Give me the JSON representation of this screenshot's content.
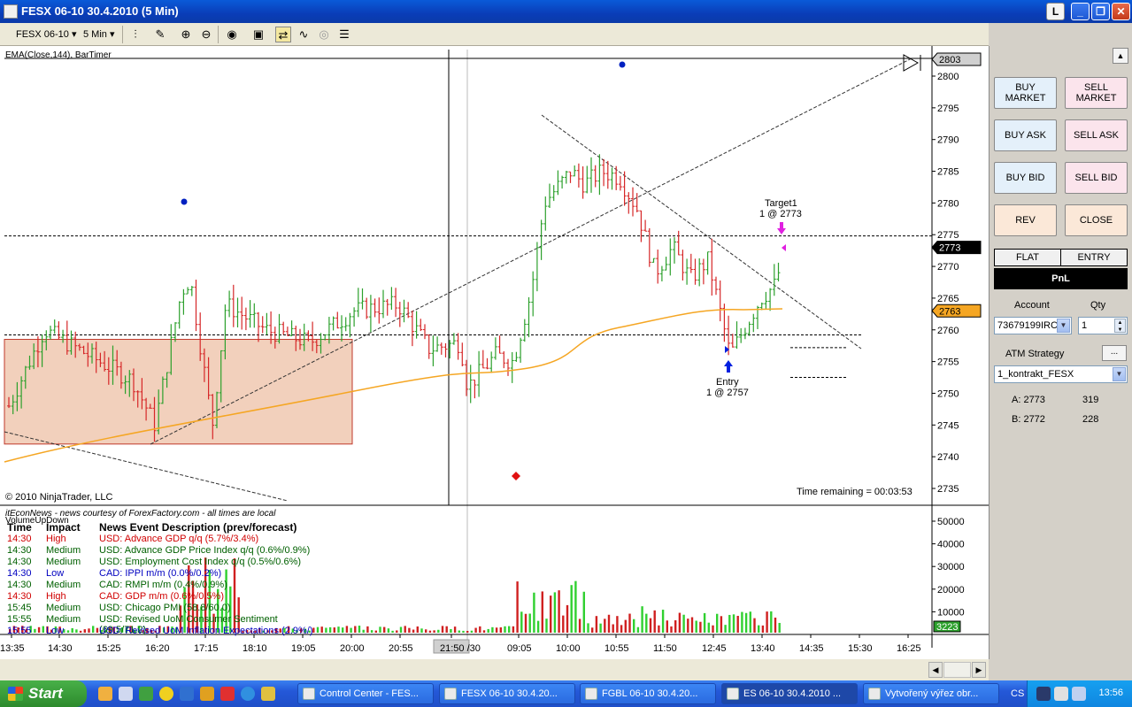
{
  "window": {
    "title": "FESX 06-10  30.4.2010  (5 Min)",
    "btn_l": "L",
    "btn_min": "_",
    "btn_max": "❐",
    "btn_close": "✕"
  },
  "toolbar": {
    "instrument": "FESX 06-10",
    "interval": "5 Min"
  },
  "chart": {
    "indicator_label": "EMA(Close,144), BarTimer",
    "copyright": "© 2010 NinjaTrader, LLC",
    "time_remaining": "Time remaining = 00:03:53",
    "price_ticks": [
      "2800",
      "2795",
      "2790",
      "2785",
      "2780",
      "2775",
      "2770",
      "2765",
      "2760",
      "2755",
      "2750",
      "2745",
      "2740",
      "2735"
    ],
    "price_top_box": "2803",
    "price_last_box": "2773",
    "price_ema_box": "2763",
    "target_label": "Target1",
    "target_qty": "1 @ 2773",
    "entry_label": "Entry",
    "entry_qty": "1 @ 2757",
    "volume_ticks": [
      "50000",
      "40000",
      "30000",
      "20000",
      "10000"
    ],
    "volume_last_box": "3223",
    "time_ticks": [
      "13:35",
      "14:30",
      "15:25",
      "16:20",
      "17:15",
      "18:10",
      "19:05",
      "20:00",
      "20:55",
      "21:50 /30",
      "09:05",
      "10:00",
      "10:55",
      "11:50",
      "12:45",
      "13:40",
      "14:35",
      "15:30",
      "16:25"
    ],
    "colors": {
      "up": "#2ca02c",
      "down": "#d62728",
      "ema": "#f5a623",
      "zone": "#f2d0bc",
      "zone_border": "#c0392b"
    }
  },
  "news": {
    "source": "itEconNews - news courtesy of ForexFactory.com - all times are local",
    "indicator": "VolumeUpDown",
    "headers": {
      "time": "Time",
      "impact": "Impact",
      "desc": "News Event Description (prev/forecast)"
    },
    "rows": [
      {
        "time": "14:30",
        "impact": "High",
        "desc": "USD: Advance GDP q/q (5.7%/3.4%)",
        "color": "#d00000"
      },
      {
        "time": "14:30",
        "impact": "Medium",
        "desc": "USD: Advance GDP Price Index q/q (0.6%/0.9%)",
        "color": "#006000"
      },
      {
        "time": "14:30",
        "impact": "Medium",
        "desc": "USD: Employment Cost Index q/q (0.5%/0.6%)",
        "color": "#006000"
      },
      {
        "time": "14:30",
        "impact": "Low",
        "desc": "CAD: IPPI m/m (0.0%/0.2%)",
        "color": "#0000c0"
      },
      {
        "time": "14:30",
        "impact": "Medium",
        "desc": "CAD: RMPI m/m (0.4%/0.9%)",
        "color": "#006000"
      },
      {
        "time": "14:30",
        "impact": "High",
        "desc": "CAD: GDP m/m (0.6%/0.5%)",
        "color": "#d00000"
      },
      {
        "time": "15:45",
        "impact": "Medium",
        "desc": "USD: Chicago PMI (58.8/60.0)",
        "color": "#006000"
      },
      {
        "time": "15:55",
        "impact": "Medium",
        "desc": "USD: Revised UoM Consumer Sentiment (69.5/71.2)",
        "color": "#006000"
      },
      {
        "time": "15:55",
        "impact": "Low",
        "desc": "USD: Revised UoM Inflation Expectations (2.9%/)",
        "color": "#0000c0"
      }
    ]
  },
  "panel": {
    "buy_market": "BUY\nMARKET",
    "sell_market": "SELL\nMARKET",
    "buy_ask": "BUY ASK",
    "sell_ask": "SELL ASK",
    "buy_bid": "BUY BID",
    "sell_bid": "SELL BID",
    "rev": "REV",
    "close": "CLOSE",
    "flat": "FLAT",
    "entry": "ENTRY",
    "pnl": "PnL",
    "account_label": "Account",
    "qty_label": "Qty",
    "account_value": "73679199IRC",
    "qty_value": "1",
    "atm_label": "ATM Strategy",
    "atm_btn": "...",
    "atm_value": "1_kontrakt_FESX",
    "ask_label": "A: 2773",
    "ask_size": "319",
    "bid_label": "B: 2772",
    "bid_size": "228"
  },
  "taskbar": {
    "start": "Start",
    "tasks": [
      "Control Center - FES...",
      "FESX 06-10  30.4.20...",
      "FGBL 06-10  30.4.20...",
      "ES 06-10  30.4.2010 ...",
      "Vytvořený výřez obr..."
    ],
    "lang": "CS",
    "clock": "13:56"
  }
}
